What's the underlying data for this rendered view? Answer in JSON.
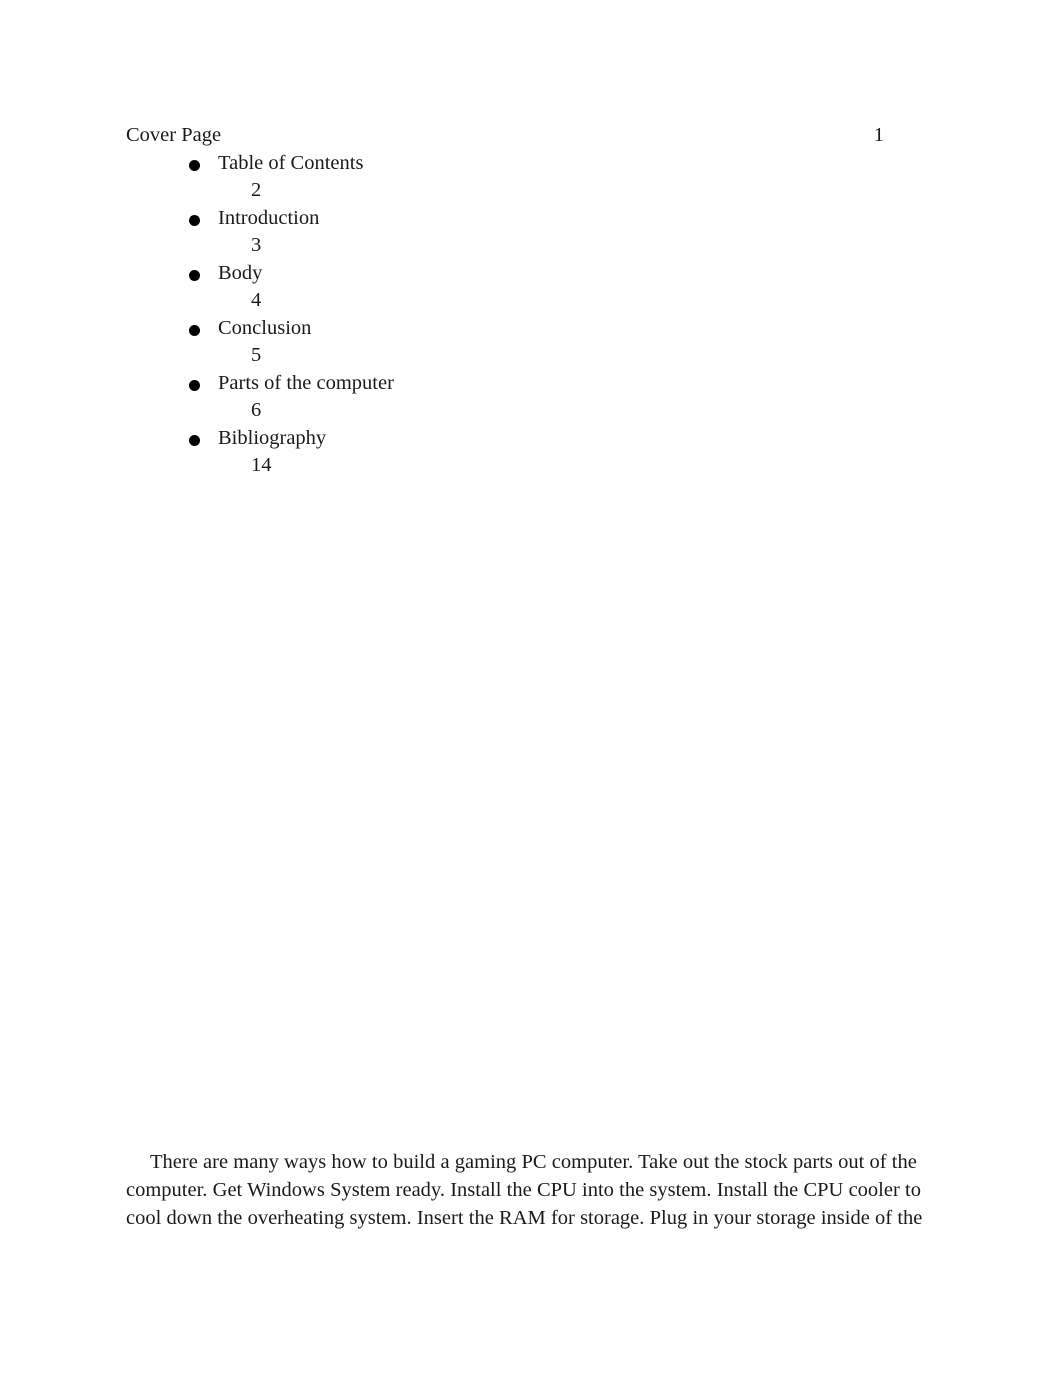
{
  "document": {
    "header": {
      "title": "Cover Page",
      "page_number": "1"
    },
    "table_of_contents": [
      {
        "label": "Table of Contents",
        "page": "2"
      },
      {
        "label": "Introduction",
        "page": "3"
      },
      {
        "label": "Body",
        "page": "4"
      },
      {
        "label": "Conclusion",
        "page": "5"
      },
      {
        "label": "Parts of the computer",
        "page": "6"
      },
      {
        "label": "Bibliography",
        "page": "14"
      }
    ],
    "body": {
      "paragraph": "There are many ways how to build a gaming PC computer. Take out the stock parts out of the computer. Get Windows System ready. Install the CPU into the system. Install the CPU cooler to cool down the overheating system. Insert the RAM for storage. Plug in your storage inside of the"
    },
    "colors": {
      "text": "#1a1a1a",
      "bullet": "#000000",
      "page_background": "#ffffff"
    }
  }
}
